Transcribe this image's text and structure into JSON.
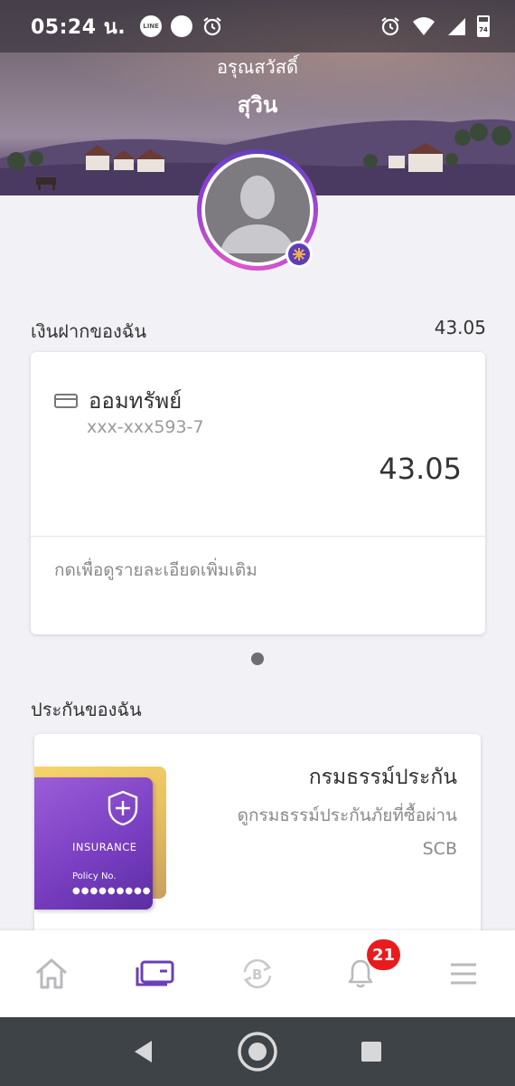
{
  "status_bar": {
    "time": "05:24 น.",
    "line_badge": "LINE",
    "left_icons": [
      "line-icon",
      "chat-bubble-icon",
      "alarm-icon"
    ],
    "right_icons": [
      "alarm-icon",
      "wifi-icon",
      "signal-icon",
      "battery-icon"
    ],
    "battery_level": "74"
  },
  "header": {
    "greeting": "อรุณสวัสดิ์",
    "user_name": "สุวิน"
  },
  "deposits": {
    "title": "เงินฝากของฉัน",
    "total": "43.05",
    "accounts": [
      {
        "name": "ออมทรัพย์",
        "number": "xxx-xxx593-7",
        "balance": "43.05",
        "more_label": "กดเพื่อดูรายละเอียดเพิ่มเติม"
      }
    ]
  },
  "insurance": {
    "title": "ประกันของฉัน",
    "card_label": "INSURANCE",
    "policy_label": "Policy No.",
    "policy_mask": "●●●●●●●●●",
    "heading": "กรมธรรม์ประกัน",
    "description_line1": "ดูกรมธรรม์ประกันภัยที่ซื้อผ่าน",
    "description_line2": "SCB"
  },
  "bottom_nav": {
    "items": [
      "home-icon",
      "card-icon",
      "bitcoin-exchange-icon",
      "bell-icon",
      "menu-icon"
    ],
    "active_index": 1,
    "notification_count": "21",
    "active_color": "#6b3fb8",
    "inactive_color": "#b9b9be"
  },
  "system_nav": [
    "back-icon",
    "home-circle-icon",
    "recents-icon"
  ]
}
